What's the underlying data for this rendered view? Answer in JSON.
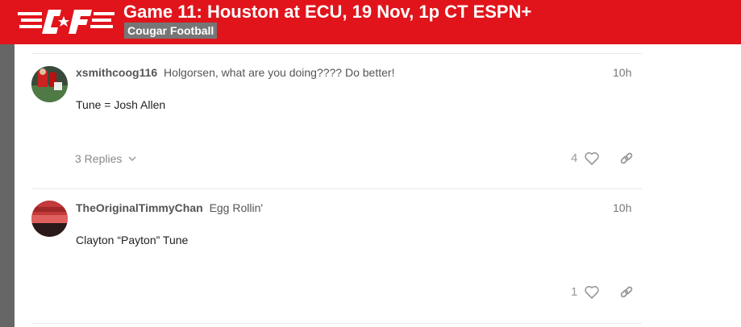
{
  "header": {
    "logo_text": "C·F",
    "topic_title": "Game 11: Houston at ECU, 19 Nov, 1p CT ESPN+",
    "category": "Cougar Football",
    "brand_color": "#e1141b"
  },
  "posts": [
    {
      "username": "xsmithcoog116",
      "user_title": "Holgorsen, what are you doing???? Do better!",
      "date": "10h",
      "body": "Tune = Josh Allen",
      "replies": "3 Replies",
      "likes": "4"
    },
    {
      "username": "TheOriginalTimmyChan",
      "user_title": "Egg Rollin'",
      "date": "10h",
      "body": "Clayton “Payton” Tune",
      "likes": "1"
    }
  ],
  "icons": {
    "like": "heart-icon",
    "share": "link-icon",
    "expand": "chevron-down-icon"
  }
}
